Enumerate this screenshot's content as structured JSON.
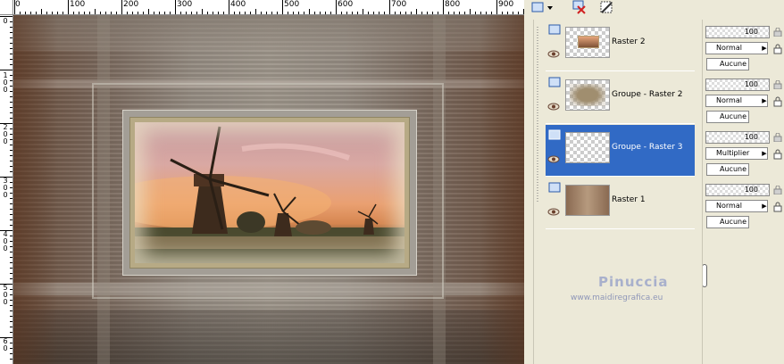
{
  "ruler": {
    "top_labels": [
      "0",
      "100",
      "200",
      "300",
      "400",
      "500",
      "600",
      "700",
      "800",
      "900"
    ],
    "left_labels": [
      "0",
      "1 0 0",
      "2 0 0",
      "3 0 0",
      "4 0 0",
      "5 0 0",
      "6 0"
    ]
  },
  "layers": [
    {
      "name": "Raster 2",
      "selected": false
    },
    {
      "name": "Groupe - Raster 2",
      "selected": false
    },
    {
      "name": "Groupe - Raster 3",
      "selected": true
    },
    {
      "name": "Raster 1",
      "selected": false
    }
  ],
  "properties": [
    {
      "opacity": "100",
      "blend": "Normal",
      "mask": "Aucune"
    },
    {
      "opacity": "100",
      "blend": "Normal",
      "mask": "Aucune"
    },
    {
      "opacity": "100",
      "blend": "Multiplier",
      "mask": "Aucune"
    },
    {
      "opacity": "100",
      "blend": "Normal",
      "mask": "Aucune"
    }
  ],
  "watermark": {
    "name": "Pinuccia",
    "url": "www.maidiregrafica.eu"
  },
  "colors": {
    "selection": "#316ac5",
    "panel_bg": "#ece9d8"
  }
}
